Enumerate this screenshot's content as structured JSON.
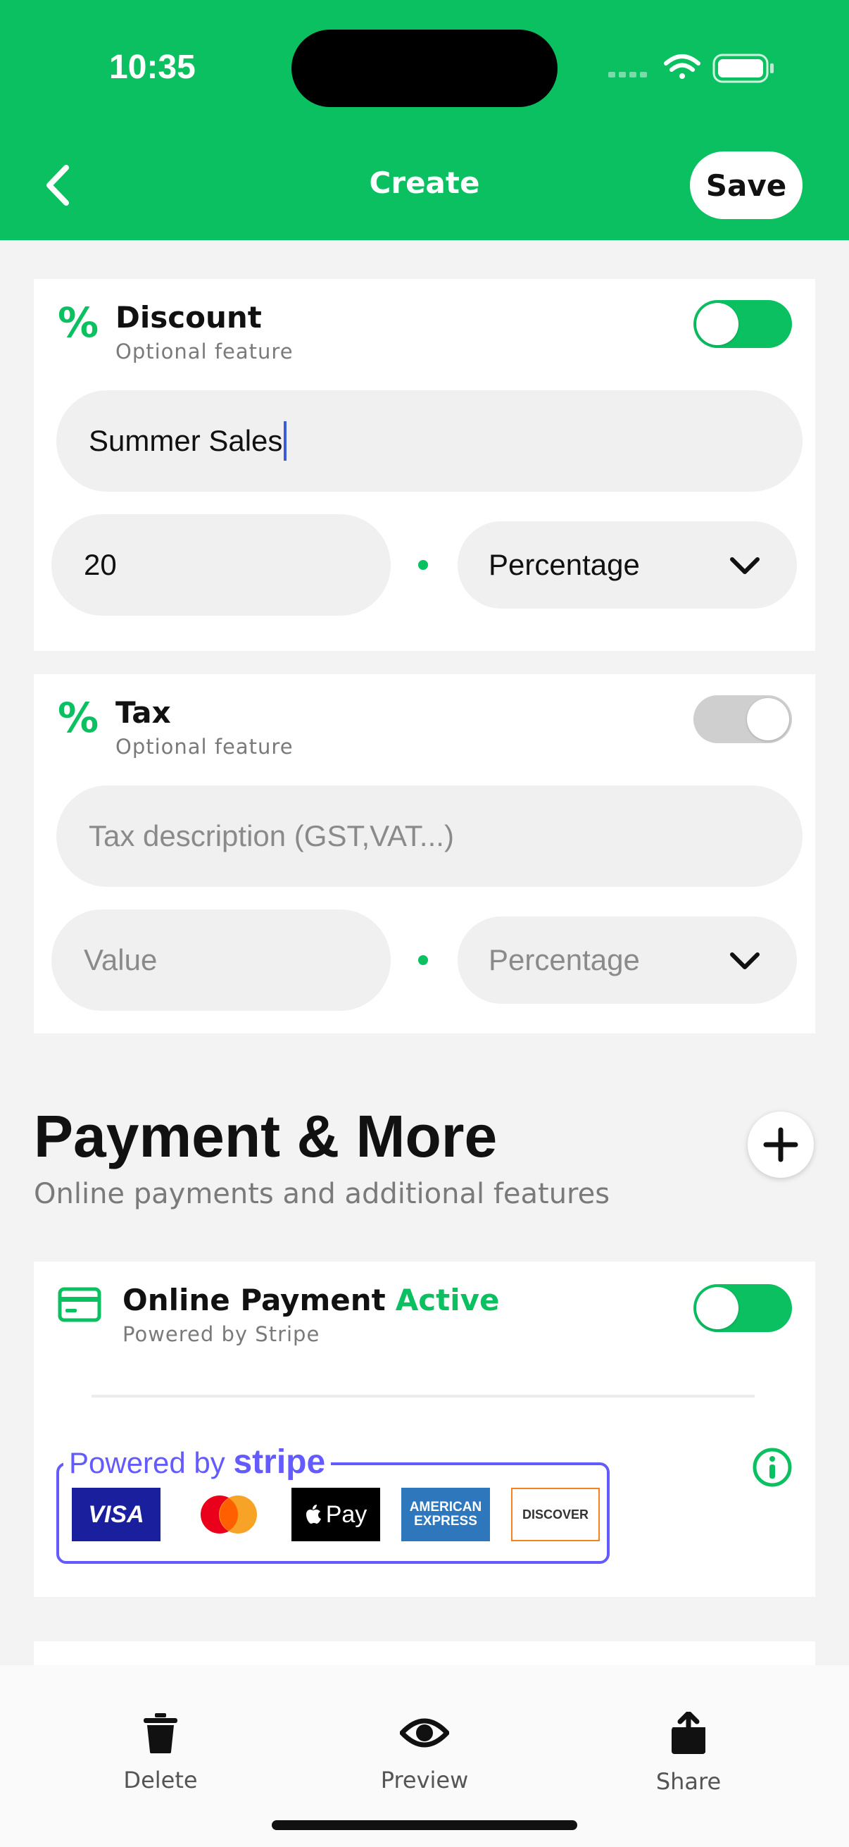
{
  "status_bar": {
    "time": "10:35"
  },
  "header": {
    "title": "Create",
    "save_label": "Save"
  },
  "discount": {
    "title": "Discount",
    "subtitle": "Optional feature",
    "enabled": true,
    "name_value": "Summer Sales",
    "amount_value": "20",
    "type_value": "Percentage"
  },
  "tax": {
    "title": "Tax",
    "subtitle": "Optional feature",
    "enabled": false,
    "description_placeholder": "Tax description (GST,VAT...)",
    "value_placeholder": "Value",
    "type_placeholder": "Percentage"
  },
  "payment_section": {
    "title": "Payment & More",
    "subtitle": "Online payments and additional features"
  },
  "online_payment": {
    "title": "Online Payment",
    "status": "Active",
    "subtitle": "Powered by Stripe",
    "enabled": true,
    "powered_by": "Powered by",
    "stripe_word": "stripe",
    "cards": [
      "VISA",
      "Mastercard",
      "Apple Pay",
      "AMERICAN EXPRESS",
      "DISCOVER"
    ],
    "apple_pay_text": "Pay",
    "amex_line1": "AMERICAN",
    "amex_line2": "EXPRESS",
    "visa_text": "VISA",
    "discover_text": "DISCOVER"
  },
  "bottom_tabs": [
    {
      "label": "Delete",
      "icon": "trash-icon"
    },
    {
      "label": "Preview",
      "icon": "eye-icon"
    },
    {
      "label": "Share",
      "icon": "share-icon"
    }
  ],
  "colors": {
    "accent": "#0bc061",
    "stripe": "#635bff"
  }
}
